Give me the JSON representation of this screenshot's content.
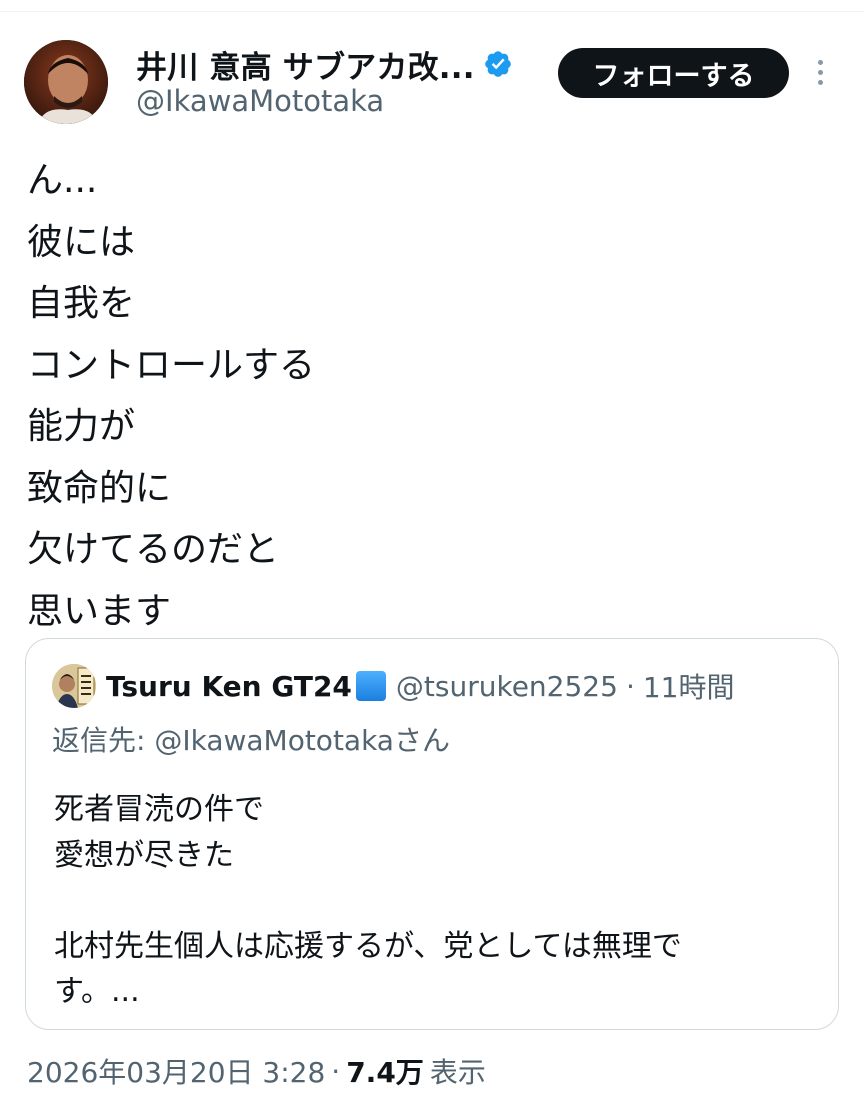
{
  "author": {
    "display_name": "井川 意高 サブアカ改...",
    "handle": "@IkawaMototaka",
    "follow_label": "フォローする"
  },
  "tweet": {
    "lines": [
      "ん...",
      "彼には",
      "自我を",
      "コントロールする",
      "能力が",
      "致命的に",
      "欠けてるのだと",
      "思います"
    ]
  },
  "quote": {
    "display_name": "Tsuru Ken GT24",
    "handle": "@tsuruken2525",
    "separator": "·",
    "time": "11時間",
    "reply_prefix": "返信先: ",
    "reply_handle": "@IkawaMototakaさん",
    "body_lines": [
      "死者冒涜の件で",
      "愛想が尽きた",
      "",
      "北村先生個人は応援するが、党としては無理で",
      "す。..."
    ]
  },
  "footer": {
    "timestamp": "2026年03月20日 3:28",
    "separator": "·",
    "views_count": "7.4万",
    "views_label": "表示"
  },
  "colors": {
    "text_primary": "#0f1419",
    "text_secondary": "#536471",
    "verified_blue": "#1d9bf0",
    "border": "#cfd9de"
  }
}
